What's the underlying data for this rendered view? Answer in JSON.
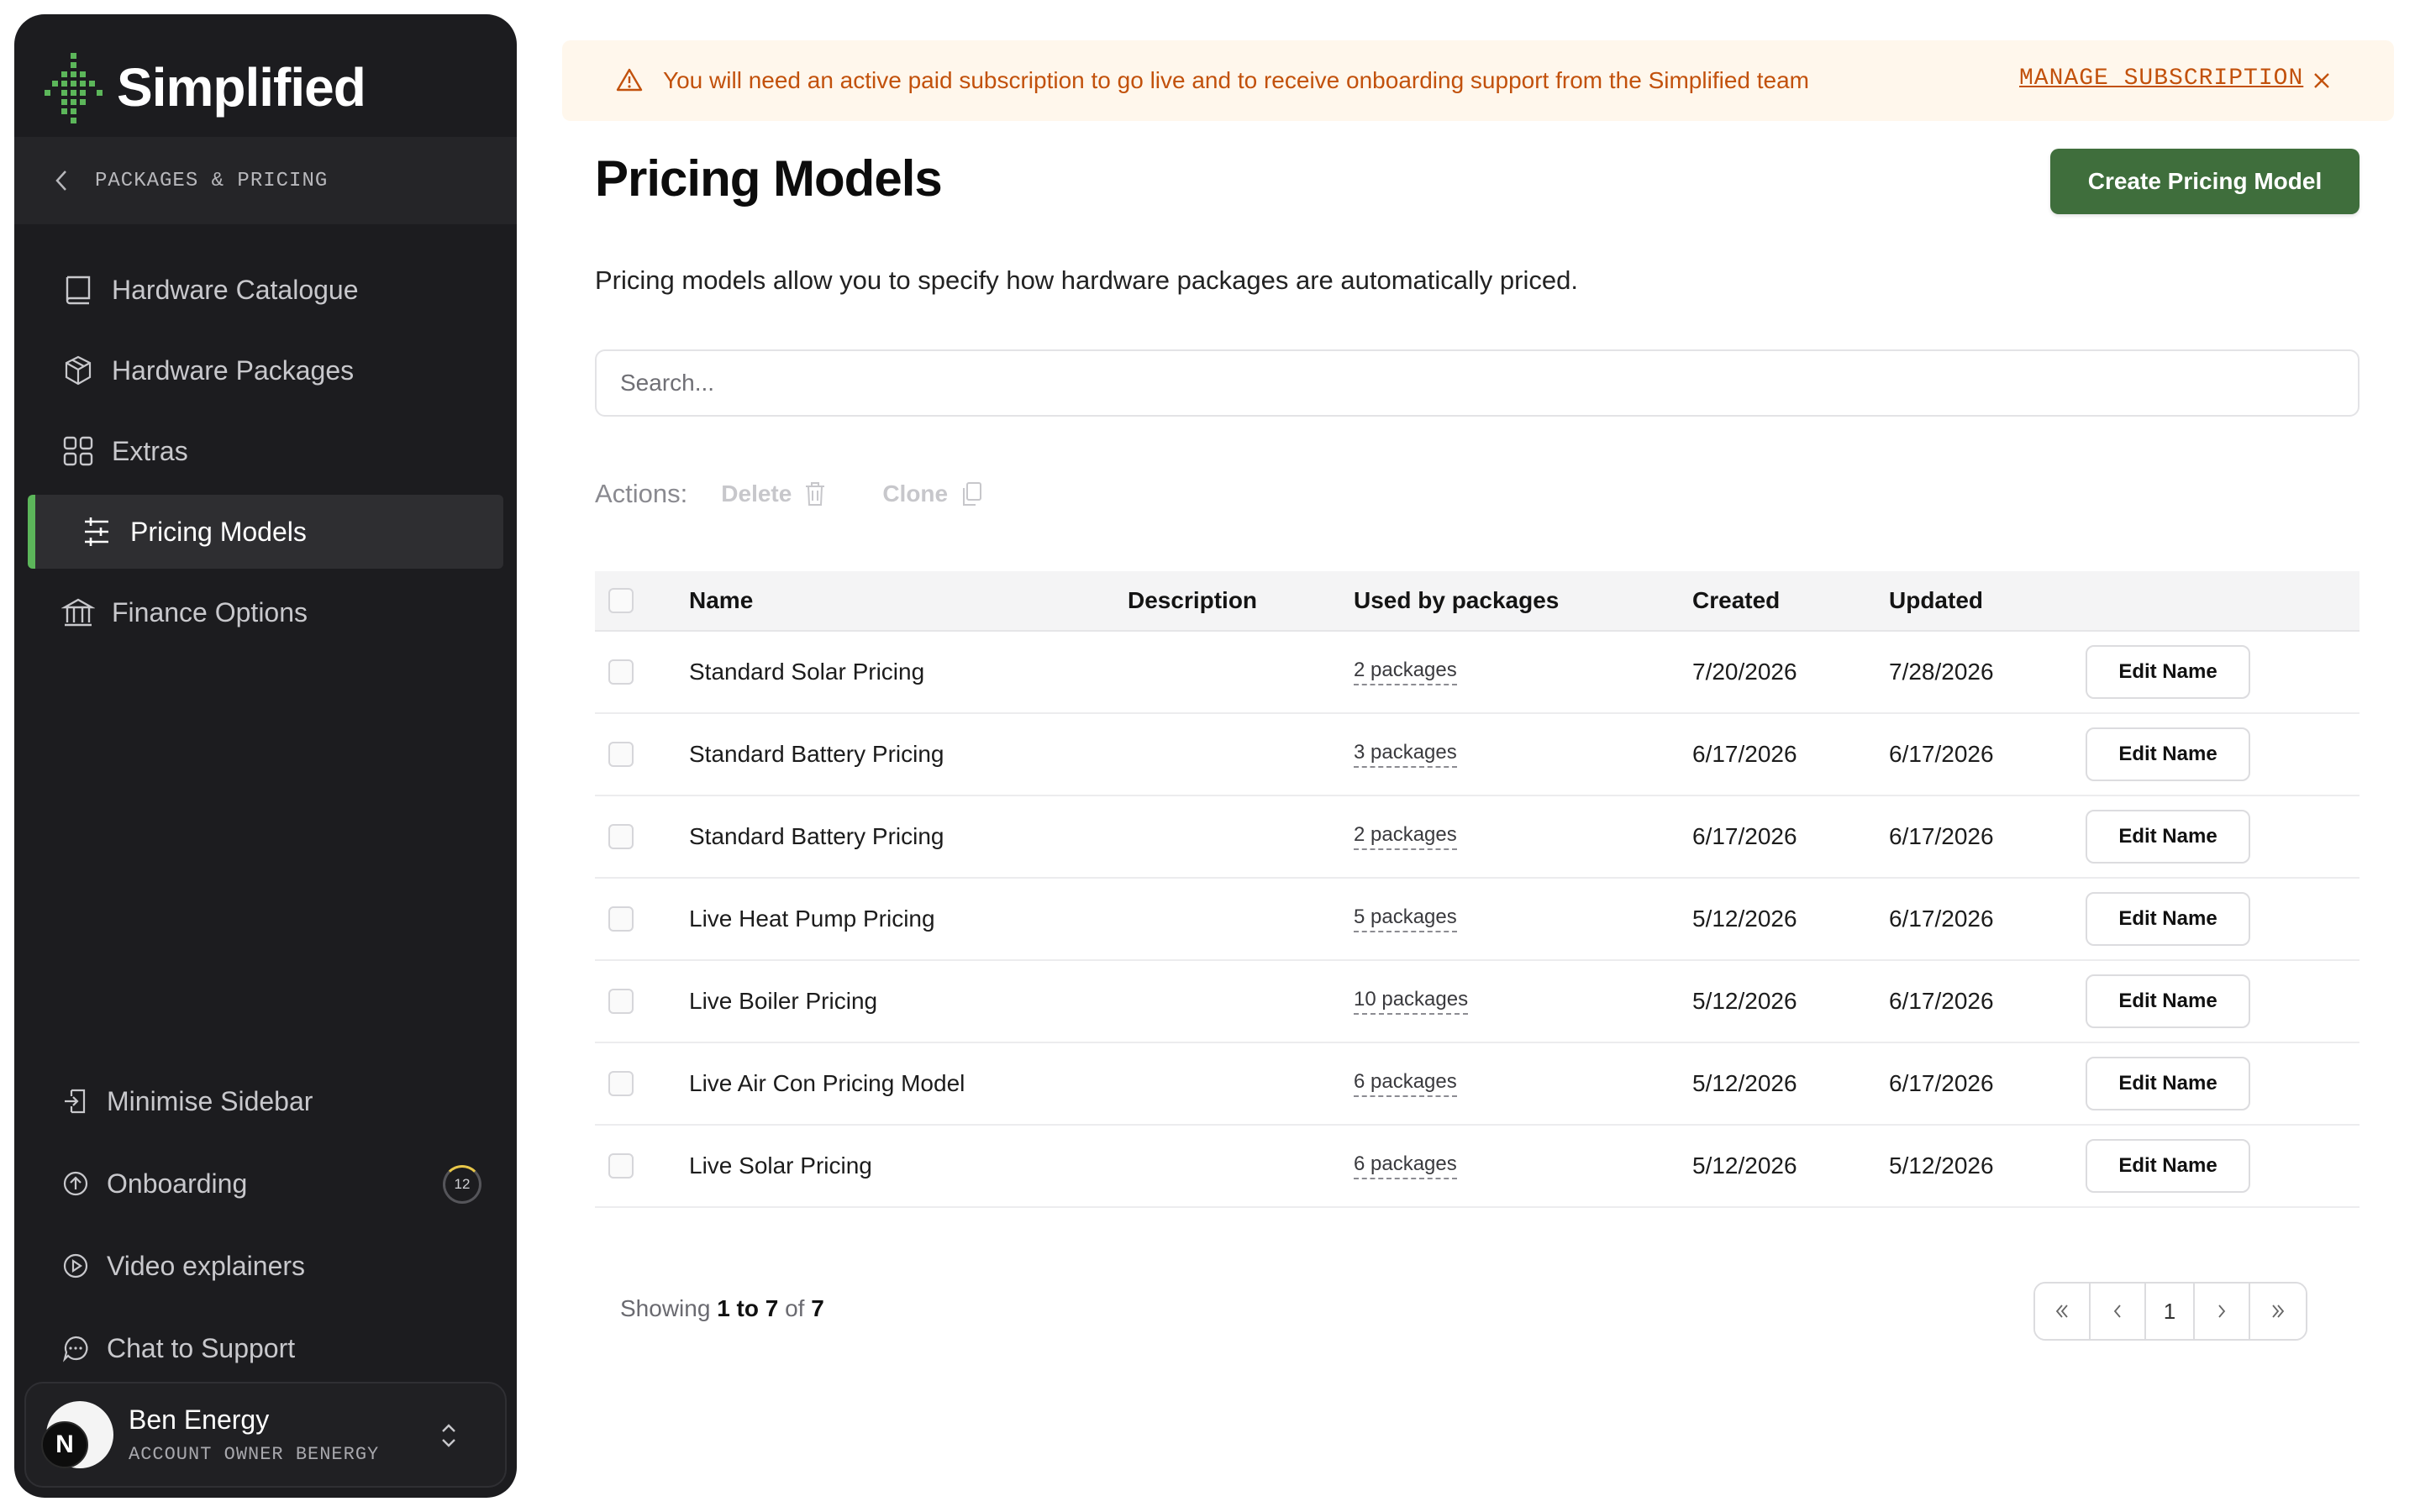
{
  "brand": {
    "name": "Simplified",
    "accent": "#5cb65a"
  },
  "sidebar": {
    "section_label": "PACKAGES & PRICING",
    "items": [
      {
        "label": "Hardware Catalogue",
        "icon": "book-icon"
      },
      {
        "label": "Hardware Packages",
        "icon": "cube-icon"
      },
      {
        "label": "Extras",
        "icon": "grid-icon"
      },
      {
        "label": "Pricing Models",
        "icon": "sliders-icon",
        "active": true
      },
      {
        "label": "Finance Options",
        "icon": "bank-icon"
      }
    ],
    "bottom_items": [
      {
        "label": "Minimise Sidebar",
        "icon": "collapse-icon"
      },
      {
        "label": "Onboarding",
        "icon": "onboarding-icon",
        "badge": "12"
      },
      {
        "label": "Video explainers",
        "icon": "play-icon"
      },
      {
        "label": "Chat to Support",
        "icon": "chat-icon"
      }
    ],
    "user": {
      "name": "Ben Energy",
      "role": "ACCOUNT OWNER  BENERGY",
      "initial": "N"
    }
  },
  "banner": {
    "text": "You will need an active paid subscription to go live and to receive onboarding support from the Simplified team",
    "link": "MANAGE SUBSCRIPTION",
    "color": "#c2510c"
  },
  "page": {
    "title": "Pricing Models",
    "create_label": "Create Pricing Model",
    "subtitle": "Pricing models allow you to specify how hardware packages are automatically priced.",
    "search_placeholder": "Search..."
  },
  "actions": {
    "label": "Actions:",
    "delete": "Delete",
    "clone": "Clone"
  },
  "table": {
    "columns": {
      "name": "Name",
      "description": "Description",
      "used": "Used by packages",
      "created": "Created",
      "updated": "Updated"
    },
    "edit_label": "Edit Name",
    "rows": [
      {
        "name": "Standard Solar Pricing",
        "description": "",
        "used": "2 packages",
        "created": "7/20/2026",
        "updated": "7/28/2026"
      },
      {
        "name": "Standard Battery Pricing",
        "description": "",
        "used": "3 packages",
        "created": "6/17/2026",
        "updated": "6/17/2026"
      },
      {
        "name": "Standard Battery Pricing",
        "description": "",
        "used": "2 packages",
        "created": "6/17/2026",
        "updated": "6/17/2026"
      },
      {
        "name": "Live Heat Pump Pricing",
        "description": "",
        "used": "5 packages",
        "created": "5/12/2026",
        "updated": "6/17/2026"
      },
      {
        "name": "Live Boiler Pricing",
        "description": "",
        "used": "10 packages",
        "created": "5/12/2026",
        "updated": "6/17/2026"
      },
      {
        "name": "Live Air Con Pricing Model",
        "description": "",
        "used": "6 packages",
        "created": "5/12/2026",
        "updated": "6/17/2026"
      },
      {
        "name": "Live Solar Pricing",
        "description": "",
        "used": "6 packages",
        "created": "5/12/2026",
        "updated": "5/12/2026"
      }
    ]
  },
  "footer": {
    "showing_prefix": "Showing",
    "range": "1 to 7",
    "of": "of",
    "total": "7",
    "current_page": "1"
  }
}
